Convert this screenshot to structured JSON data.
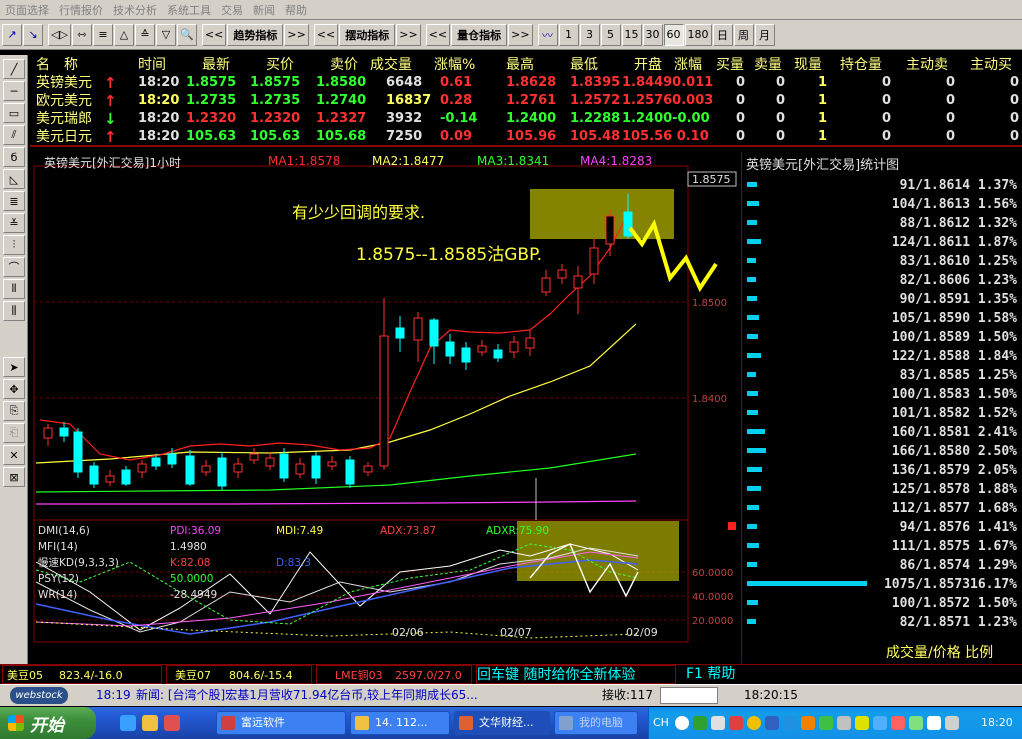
{
  "menu": [
    "页面选择",
    "行情报价",
    "技术分析",
    "系统工具",
    "交易",
    "新闻",
    "帮助"
  ],
  "toolbar": {
    "trend_label": "趋势指标",
    "swing_label": "摆动指标",
    "volume_label": "量仓指标",
    "more_label": ">>",
    "back_label": "<<",
    "periods": [
      "1",
      "3",
      "5",
      "15",
      "30",
      "60",
      "180",
      "日",
      "周",
      "月"
    ],
    "active_period": "60"
  },
  "quote_table": {
    "headers": [
      "名　称",
      "时间",
      "最新",
      "买价",
      "卖价",
      "成交量",
      "涨幅%",
      "最高",
      "最低",
      "开盘",
      "涨幅",
      "买量",
      "卖量",
      "现量",
      "持仓量",
      "主动卖",
      "主动买"
    ],
    "rows": [
      {
        "name": "英镑美元",
        "arrow": "↑",
        "time": "18:20",
        "last": "1.8575",
        "bid": "1.8575",
        "ask": "1.8580",
        "volume": "6648",
        "change_pct": "0.61",
        "high": "1.8628",
        "low": "1.8395",
        "open_change": "1.84490.011",
        "bid_qty": "0",
        "ask_qty": "0",
        "cur_qty": "1",
        "open_int": "0",
        "active_sell": "0",
        "active_buy": "0"
      },
      {
        "name": "欧元美元",
        "arrow": "↑",
        "time": "18:20",
        "last": "1.2735",
        "bid": "1.2735",
        "ask": "1.2740",
        "volume": "16837",
        "change_pct": "0.28",
        "high": "1.2761",
        "low": "1.2572",
        "open_change": "1.25760.003",
        "bid_qty": "0",
        "ask_qty": "0",
        "cur_qty": "1",
        "open_int": "0",
        "active_sell": "0",
        "active_buy": "0"
      },
      {
        "name": "美元瑞郎",
        "arrow": "↓",
        "time": "18:20",
        "last": "1.2320",
        "bid": "1.2320",
        "ask": "1.2327",
        "volume": "3932",
        "change_pct": "-0.14",
        "high": "1.2400",
        "low": "1.2288",
        "open_change": "1.2400-0.00",
        "bid_qty": "0",
        "ask_qty": "0",
        "cur_qty": "1",
        "open_int": "0",
        "active_sell": "0",
        "active_buy": "0"
      },
      {
        "name": "美元日元",
        "arrow": "↑",
        "time": "18:20",
        "last": "105.63",
        "bid": "105.63",
        "ask": "105.68",
        "volume": "7250",
        "change_pct": "0.09",
        "high": "105.96",
        "low": "105.48",
        "open_change": "105.56 0.10",
        "bid_qty": "0",
        "ask_qty": "0",
        "cur_qty": "1",
        "open_int": "0",
        "active_sell": "0",
        "active_buy": "0"
      }
    ]
  },
  "chart": {
    "title": "英镑美元[外汇交易]1小时",
    "ma1": "MA1:1.8578",
    "ma2": "MA2:1.8477",
    "ma3": "MA3:1.8341",
    "ma4": "MA4:1.8283",
    "current_price_tag": "1.8575",
    "y_ticks": [
      "1.8500",
      "1.8400"
    ],
    "annotation_1": "有少少回调的要求.",
    "annotation_2": "1.8575--1.8585沽GBP.",
    "dates": [
      "02/06",
      "02/07",
      "02/09"
    ],
    "indicators": {
      "dmi": "DMI(14,6)",
      "pdi": "PDI:36.09",
      "mdi": "MDI:7.49",
      "adx": "ADX:73.87",
      "adxr": "ADXR:75.90",
      "mfi": "MFI(14)",
      "mfi_val": "1.4980",
      "kd": "慢速KD(9,3,3,3)",
      "k": "K:82.08",
      "d": "D:83.3",
      "psy": "PSY(12)",
      "psy_val": "50.0000",
      "wr": "WR(14)",
      "wr_val": "-28.4949",
      "levels": [
        "60.0000",
        "40.0000",
        "20.0000"
      ]
    },
    "colors": {
      "up": "#ff3030",
      "down": "#00ffff",
      "ma1": "#ff2020",
      "ma2": "#ffff40",
      "ma3": "#20ff20",
      "ma4": "#ff40ff",
      "highlight": "#b0b000"
    }
  },
  "distribution": {
    "title": "英镑美元[外汇交易]统计图",
    "rows": [
      {
        "text": "91/1.8614 1.37%",
        "pct": 1.37
      },
      {
        "text": "104/1.8613 1.56%",
        "pct": 1.56
      },
      {
        "text": "88/1.8612 1.32%",
        "pct": 1.32
      },
      {
        "text": "124/1.8611 1.87%",
        "pct": 1.87
      },
      {
        "text": "83/1.8610 1.25%",
        "pct": 1.25
      },
      {
        "text": "82/1.8606 1.23%",
        "pct": 1.23
      },
      {
        "text": "90/1.8591 1.35%",
        "pct": 1.35
      },
      {
        "text": "105/1.8590 1.58%",
        "pct": 1.58
      },
      {
        "text": "100/1.8589 1.50%",
        "pct": 1.5
      },
      {
        "text": "122/1.8588 1.84%",
        "pct": 1.84
      },
      {
        "text": "83/1.8585 1.25%",
        "pct": 1.25
      },
      {
        "text": "100/1.8583 1.50%",
        "pct": 1.5
      },
      {
        "text": "101/1.8582 1.52%",
        "pct": 1.52
      },
      {
        "text": "160/1.8581 2.41%",
        "pct": 2.41
      },
      {
        "text": "166/1.8580 2.50%",
        "pct": 2.5
      },
      {
        "text": "136/1.8579 2.05%",
        "pct": 2.05
      },
      {
        "text": "125/1.8578 1.88%",
        "pct": 1.88
      },
      {
        "text": "112/1.8577 1.68%",
        "pct": 1.68
      },
      {
        "text": "94/1.8576 1.41%",
        "pct": 1.41
      },
      {
        "text": "111/1.8575 1.67%",
        "pct": 1.67
      },
      {
        "text": "86/1.8574 1.29%",
        "pct": 1.29
      },
      {
        "text": "1075/1.857316.17%",
        "pct": 16.17
      },
      {
        "text": "100/1.8572 1.50%",
        "pct": 1.5
      },
      {
        "text": "82/1.8571 1.23%",
        "pct": 1.23
      }
    ],
    "footer": "成交量/价格 比例"
  },
  "ticker": {
    "item1_name": "美豆05",
    "item1_val": "823.4/-16.0",
    "item2_name": "美豆07",
    "item2_val": "804.6/-15.4",
    "item3_name": "LME铜03",
    "item3_val": "2597.0/27.0",
    "hint": "回车键 随时给你全新体验",
    "help": "F1 帮助"
  },
  "newsbar": {
    "logo": "webstock",
    "time": "18:19",
    "news": "新闻: [台湾个股]宏基1月营收71.94亿台币,较上年同期成长65...",
    "recv_label": "接收:117",
    "clock": "18:20:15"
  },
  "taskbar": {
    "start": "开始",
    "tasks": [
      "富远软件",
      "14. 112...",
      "文华财经...",
      "我的电脑"
    ],
    "ime": "CH",
    "clock": "18:20"
  }
}
